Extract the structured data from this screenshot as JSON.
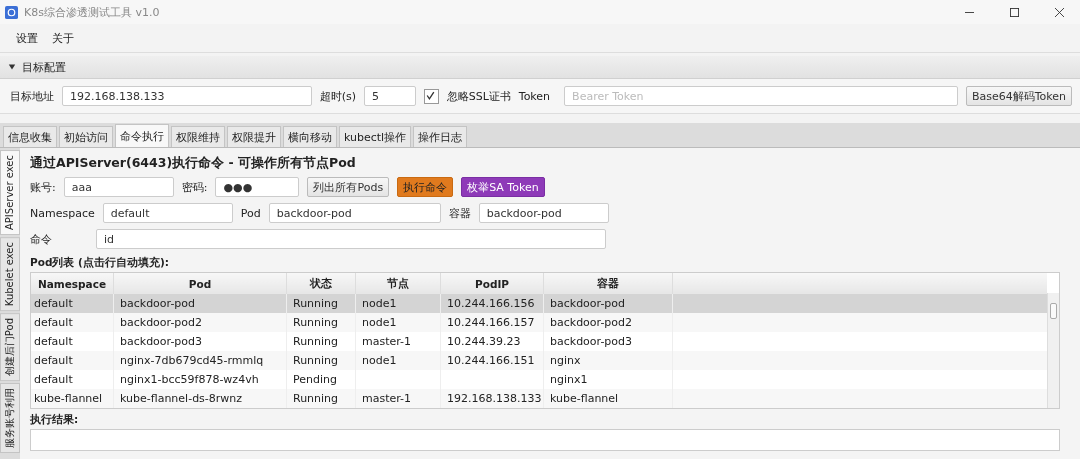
{
  "window": {
    "title": "K8s综合渗透测试工具 v1.0"
  },
  "menu": [
    "设置",
    "关于"
  ],
  "target_config": {
    "title": "目标配置",
    "expanded": true,
    "address_label": "目标地址",
    "address": "192.168.138.133",
    "timeout_label": "超时(s)",
    "timeout": "5",
    "ignore_ssl": {
      "label": "忽略SSL证书",
      "checked": true
    },
    "token_label": "Token",
    "token_placeholder": "Bearer Token",
    "decode_button": "Base64解码Token"
  },
  "tabs": [
    {
      "label": "信息收集",
      "selected": false
    },
    {
      "label": "初始访问",
      "selected": false
    },
    {
      "label": "命令执行",
      "selected": true
    },
    {
      "label": "权限维持",
      "selected": false
    },
    {
      "label": "权限提升",
      "selected": false
    },
    {
      "label": "横向移动",
      "selected": false
    },
    {
      "label": "kubectl操作",
      "selected": false
    },
    {
      "label": "操作日志",
      "selected": false
    }
  ],
  "side_tabs": [
    {
      "label": "APIServer exec",
      "selected": true
    },
    {
      "label": "Kubelet exec",
      "selected": false
    },
    {
      "label": "创建后门Pod",
      "selected": false
    },
    {
      "label": "服务账号利用",
      "selected": false
    }
  ],
  "panel": {
    "heading": "通过APIServer(6443)执行命令 - 可操作所有节点Pod",
    "account_label": "账号:",
    "account": "aaa",
    "password_label": "密码:",
    "password": "●●●",
    "buttons": [
      {
        "label": "列出所有Pods",
        "kind": "plain"
      },
      {
        "label": "执行命令",
        "kind": "orange"
      },
      {
        "label": "枚举SA Token",
        "kind": "purple"
      }
    ],
    "namespace_label": "Namespace",
    "namespace": "default",
    "pod_label": "Pod",
    "pod": "backdoor-pod",
    "container_label": "容器",
    "container": "backdoor-pod",
    "command_label": "命令",
    "command": "id",
    "list_label": "Pod列表 (点击行自动填充):",
    "table": {
      "columns": [
        "Namespace",
        "Pod",
        "状态",
        "节点",
        "PodIP",
        "容器"
      ],
      "rows": [
        {
          "cells": [
            "default",
            "backdoor-pod",
            "Running",
            "node1",
            "10.244.166.156",
            "backdoor-pod"
          ],
          "selected": true
        },
        {
          "cells": [
            "default",
            "backdoor-pod2",
            "Running",
            "node1",
            "10.244.166.157",
            "backdoor-pod2"
          ],
          "selected": false
        },
        {
          "cells": [
            "default",
            "backdoor-pod3",
            "Running",
            "master-1",
            "10.244.39.23",
            "backdoor-pod3"
          ],
          "selected": false
        },
        {
          "cells": [
            "default",
            "nginx-7db679cd45-rmmlq",
            "Running",
            "node1",
            "10.244.166.151",
            "nginx"
          ],
          "selected": false
        },
        {
          "cells": [
            "default",
            "nginx1-bcc59f878-wz4vh",
            "Pending",
            "",
            "",
            "nginx1"
          ],
          "selected": false
        },
        {
          "cells": [
            "kube-flannel",
            "kube-flannel-ds-8rwnz",
            "Running",
            "master-1",
            "192.168.138.133",
            "kube-flannel"
          ],
          "selected": false
        }
      ]
    },
    "result_label": "执行结果:"
  }
}
